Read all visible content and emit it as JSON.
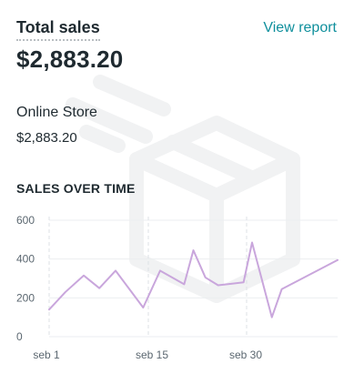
{
  "card": {
    "title": "Total sales",
    "view_report_label": "View report",
    "total_value": "$2,883.20"
  },
  "channel": {
    "name": "Online Store",
    "value": "$2,883.20"
  },
  "section_title": "SALES OVER TIME",
  "colors": {
    "accent_link": "#0f8f9c",
    "line": "#c9a6dc"
  },
  "icons": [
    "box-illustration-icon"
  ],
  "chart_data": {
    "type": "line",
    "title": "SALES OVER TIME",
    "xlabel": "",
    "ylabel": "",
    "x_tick_labels": [
      "seb 1",
      "seb 15",
      "seb 30"
    ],
    "y_ticks": [
      0,
      200,
      400,
      600
    ],
    "ylim": [
      0,
      600
    ],
    "grid": true,
    "series": [
      {
        "values": [
          140,
          230,
          315,
          250,
          340,
          150,
          340,
          270,
          445,
          305,
          265,
          280,
          485,
          100,
          245,
          395
        ]
      }
    ],
    "x_positions": [
      0.0,
      0.115,
      0.245,
      0.355,
      0.47,
      0.665,
      0.785,
      0.955,
      1.02,
      1.105,
      1.195,
      1.375,
      1.435,
      1.575,
      1.645,
      2.04
    ]
  }
}
